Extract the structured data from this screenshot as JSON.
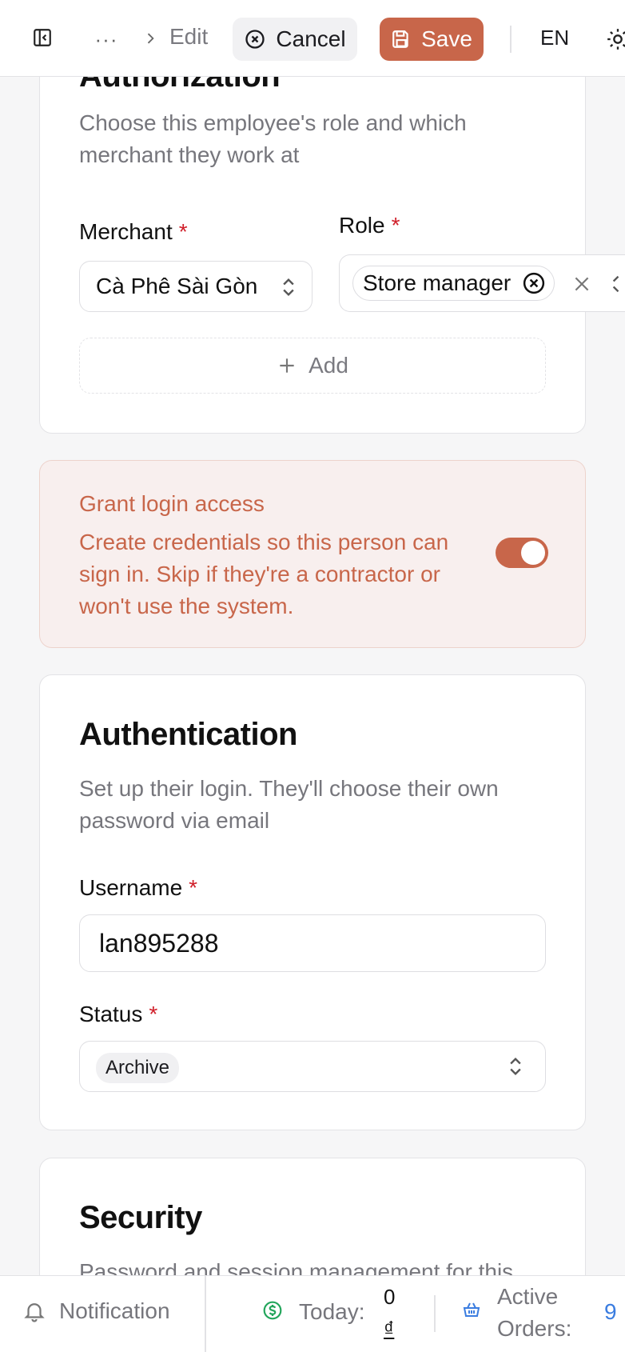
{
  "toolbar": {
    "breadcrumb_more": "···",
    "breadcrumb_current": "Edit",
    "cancel_label": "Cancel",
    "save_label": "Save",
    "language": "EN"
  },
  "authorization": {
    "title": "Authorization",
    "description": "Choose this employee's role and which merchant they work at",
    "merchant_label": "Merchant",
    "merchant_value": "Cà Phê Sài Gòn",
    "role_label": "Role",
    "role_chip": "Store manager",
    "add_label": "Add",
    "required_mark": "*"
  },
  "grant_login": {
    "title": "Grant login access",
    "description": "Create credentials so this person can sign in. Skip if they're a contractor or won't use the system.",
    "enabled": true
  },
  "authentication": {
    "title": "Authentication",
    "description": "Set up their login. They'll choose their own password via email",
    "username_label": "Username",
    "username_value": "lan895288",
    "status_label": "Status",
    "status_value": "Archive"
  },
  "security": {
    "title": "Security",
    "description": "Password and session management for this"
  },
  "bottombar": {
    "notification_label": "Notification",
    "today_label": "Today:",
    "today_value_num": "0",
    "today_value_cur": "₫",
    "active_orders_label_1": "Active",
    "active_orders_label_2": "Orders:",
    "active_orders_value": "9"
  },
  "colors": {
    "accent": "#c8664a",
    "required": "#d01f2a",
    "money_icon": "#22a55b",
    "orders_blue": "#3b7de0"
  }
}
